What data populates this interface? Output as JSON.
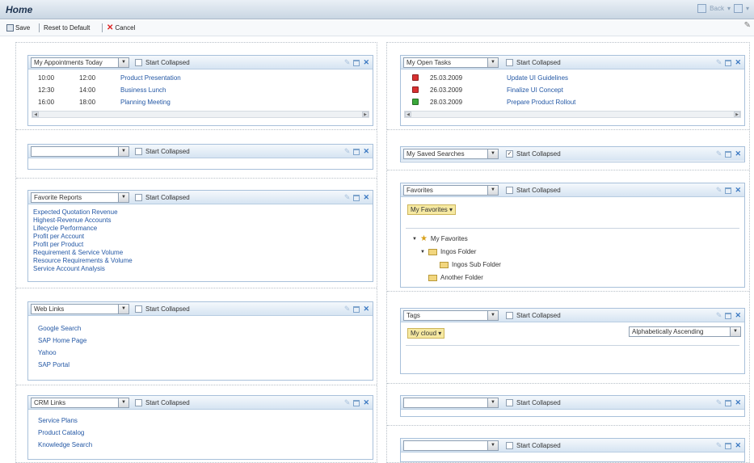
{
  "window": {
    "title": "Home",
    "back_label": "Back"
  },
  "toolbar": {
    "save": "Save",
    "reset": "Reset to Default",
    "cancel": "Cancel"
  },
  "common": {
    "start_collapsed": "Start Collapsed"
  },
  "left": {
    "appointments": {
      "select": "My Appointments Today",
      "start_collapsed_checked": false,
      "rows": [
        {
          "start": "10:00",
          "end": "12:00",
          "title": "Product Presentation"
        },
        {
          "start": "12:30",
          "end": "14:00",
          "title": "Business Lunch"
        },
        {
          "start": "16:00",
          "end": "18:00",
          "title": "Planning Meeting"
        }
      ]
    },
    "empty1": {
      "select": "",
      "start_collapsed_checked": false
    },
    "reports": {
      "select": "Favorite Reports",
      "start_collapsed_checked": false,
      "links": [
        "Expected Quotation Revenue",
        "Highest-Revenue Accounts",
        "Lifecycle Performance",
        "Profit per Account",
        "Profit per Product",
        "Requirement & Service Volume",
        "Resource Requirements & Volume",
        "Service Account Analysis"
      ]
    },
    "weblinks": {
      "select": "Web Links",
      "start_collapsed_checked": false,
      "links": [
        "Google Search",
        "SAP Home Page",
        "Yahoo",
        "SAP Portal"
      ]
    },
    "crmlinks": {
      "select": "CRM Links",
      "start_collapsed_checked": false,
      "links": [
        "Service Plans",
        "Product Catalog",
        "Knowledge Search"
      ]
    }
  },
  "right": {
    "tasks": {
      "select": "My Open Tasks",
      "start_collapsed_checked": false,
      "rows": [
        {
          "status_color": "#d83030",
          "date": "25.03.2009",
          "title": "Update UI Guidelines"
        },
        {
          "status_color": "#d83030",
          "date": "26.03.2009",
          "title": "Finalize UI Concept"
        },
        {
          "status_color": "#3aa83a",
          "date": "28.03.2009",
          "title": "Prepare Product Rollout"
        }
      ]
    },
    "saved_searches": {
      "select": "My Saved Searches",
      "start_collapsed_checked": true
    },
    "favorites": {
      "select": "Favorites",
      "start_collapsed_checked": false,
      "button": "My Favorites",
      "tree": {
        "root": "My Favorites",
        "folder1": "Ingos Folder",
        "subfolder": "Ingos Sub Folder",
        "folder2": "Another Folder"
      }
    },
    "tags": {
      "select": "Tags",
      "start_collapsed_checked": false,
      "button": "My cloud",
      "sort": "Alphabetically Ascending"
    },
    "empty1": {
      "select": "",
      "start_collapsed_checked": false
    },
    "empty2": {
      "select": "",
      "start_collapsed_checked": false
    }
  }
}
